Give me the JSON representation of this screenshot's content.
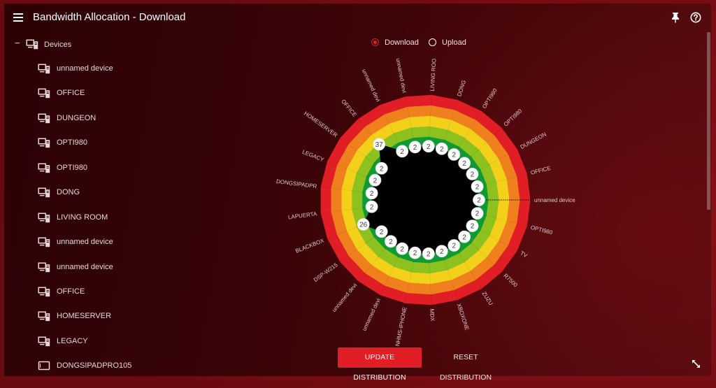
{
  "header": {
    "title": "Bandwidth Allocation - Download",
    "menu_icon": "hamburger-menu-icon",
    "pin_icon": "pin-icon",
    "help_icon": "help-circle-icon"
  },
  "sidebar": {
    "root": {
      "toggle": "−",
      "label": "Devices",
      "icon": "devices-icon"
    },
    "items": [
      {
        "label": "unnamed device",
        "icon": "desktop-icon"
      },
      {
        "label": "OFFICE",
        "icon": "desktop-icon"
      },
      {
        "label": "DUNGEON",
        "icon": "desktop-icon"
      },
      {
        "label": "OPTI980",
        "icon": "desktop-icon"
      },
      {
        "label": "OPTI980",
        "icon": "desktop-icon"
      },
      {
        "label": "DONG",
        "icon": "desktop-icon"
      },
      {
        "label": "LIVING ROOM",
        "icon": "desktop-icon"
      },
      {
        "label": "unnamed device",
        "icon": "desktop-icon"
      },
      {
        "label": "unnamed device",
        "icon": "desktop-icon"
      },
      {
        "label": "OFFICE",
        "icon": "desktop-icon"
      },
      {
        "label": "HOMESERVER",
        "icon": "desktop-icon"
      },
      {
        "label": "LEGACY",
        "icon": "desktop-icon"
      },
      {
        "label": "DONGSIPADPRO105",
        "icon": "tablet-icon"
      }
    ]
  },
  "direction_toggle": {
    "options": [
      {
        "label": "Download",
        "selected": true
      },
      {
        "label": "Upload",
        "selected": false
      }
    ]
  },
  "actions": {
    "update_label": "UPDATE DISTRIBUTION",
    "reset_label": "RESET DISTRIBUTION",
    "resize_icon": "resize-diagonal-icon"
  },
  "colors": {
    "accent": "#e11d25",
    "background": "#3a0508",
    "frame": "#7c0e14",
    "data_fill": "#000000"
  },
  "chart_data": {
    "type": "area",
    "coordinate_system": "polar",
    "direction": "counterclockwise",
    "start_angle_deg": 0,
    "radial_range": [
      0,
      100
    ],
    "categories": [
      "unnamed device",
      "OFFICE",
      "DUNGEON",
      "OPTI980",
      "OPTI980",
      "DONG",
      "LIVING ROO",
      "unnamed devi",
      "unnamed devi",
      "OFFICE",
      "HOMESERVER",
      "LEGACY",
      "DONGSIPADPR",
      "LAPUERTA",
      "BLACKBOX",
      "DSP-W215",
      "unnamed devi",
      "unnamed devi",
      "NHMS-IPHONE",
      "MDX",
      "XBOXONE",
      "ZUZU",
      "R7500",
      "TV",
      "OPTI980"
    ],
    "values": [
      2,
      2,
      2,
      2,
      2,
      2,
      2,
      2,
      2,
      37,
      2,
      2,
      2,
      2,
      26,
      2,
      2,
      2,
      2,
      2,
      2,
      2,
      2,
      2,
      2
    ],
    "bands": [
      {
        "name": "dark-green",
        "from": 0,
        "to": 20,
        "color": "#0f9a33"
      },
      {
        "name": "light-green",
        "from": 20,
        "to": 40,
        "color": "#8dc11f"
      },
      {
        "name": "yellow",
        "from": 40,
        "to": 60,
        "color": "#f3d11a"
      },
      {
        "name": "orange",
        "from": 60,
        "to": 80,
        "color": "#f07f1d"
      },
      {
        "name": "red",
        "from": 80,
        "to": 100,
        "color": "#e11d25"
      }
    ],
    "title": "",
    "legend": "none"
  }
}
